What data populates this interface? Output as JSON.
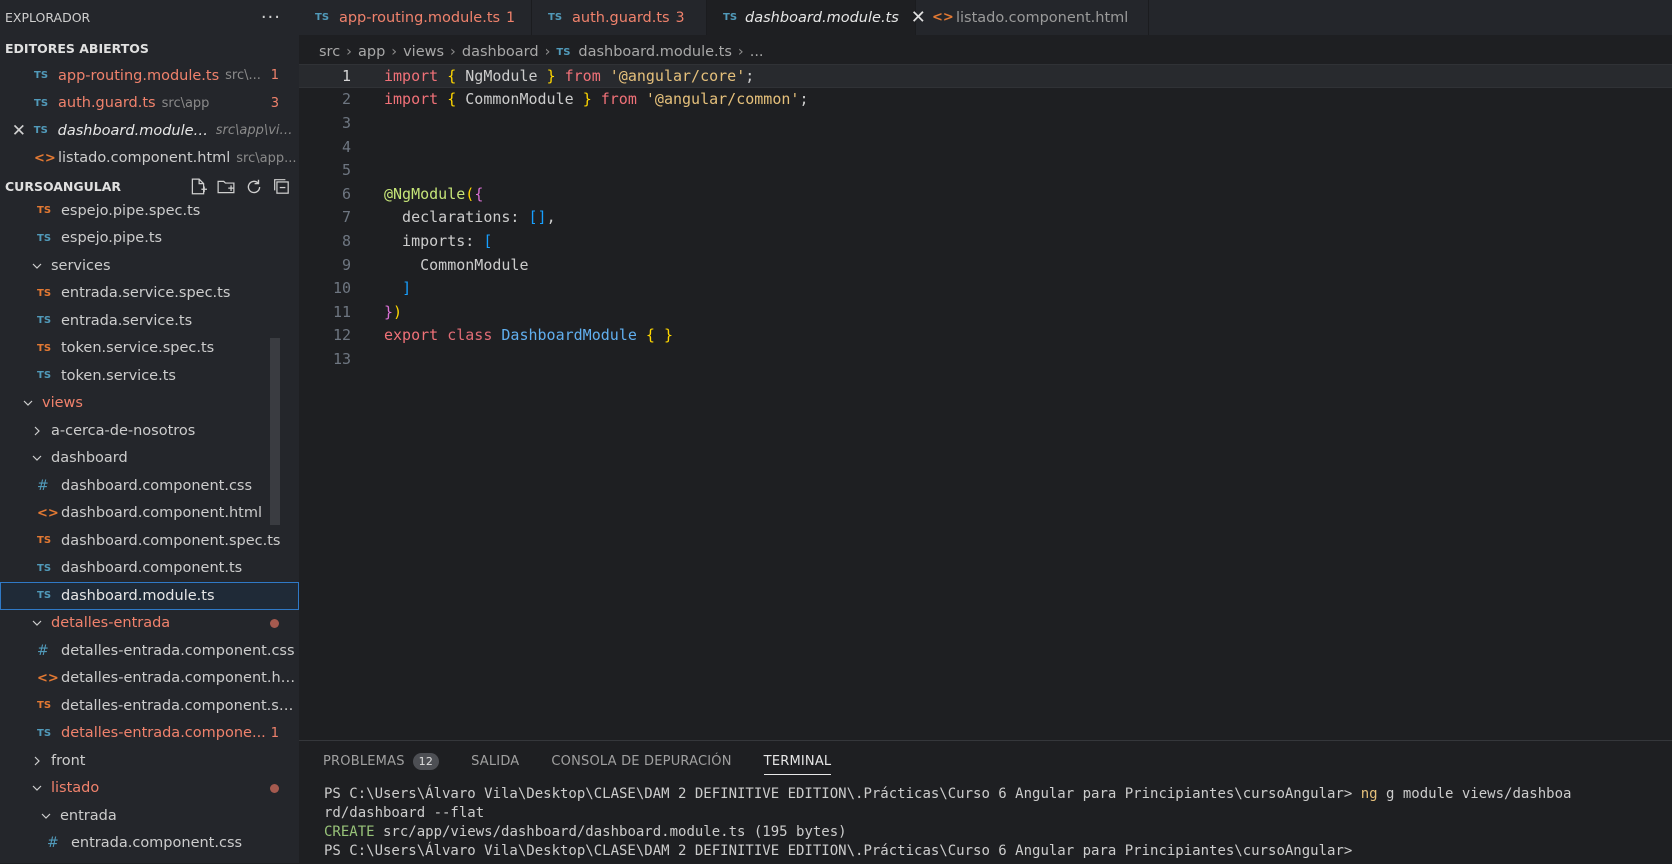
{
  "explorer": {
    "title": "EXPLORADOR",
    "more_label": "···",
    "open_editors_header": "EDITORES ABIERTOS",
    "open_editors": [
      {
        "name": "app-routing.module.ts",
        "path": "src\\...",
        "badge": "1"
      },
      {
        "name": "auth.guard.ts",
        "path": "src\\app",
        "badge": "3"
      },
      {
        "name": "dashboard.module.ts",
        "path": "src\\app\\vie..."
      },
      {
        "name": "listado.component.html",
        "path": "src\\app..."
      }
    ],
    "project_header": "CURSOANGULAR",
    "tree": [
      {
        "name": "espejo.pipe.spec.ts"
      },
      {
        "name": "espejo.pipe.ts"
      },
      {
        "name": "services"
      },
      {
        "name": "entrada.service.spec.ts"
      },
      {
        "name": "entrada.service.ts"
      },
      {
        "name": "token.service.spec.ts"
      },
      {
        "name": "token.service.ts"
      },
      {
        "name": "views"
      },
      {
        "name": "a-cerca-de-nosotros"
      },
      {
        "name": "dashboard"
      },
      {
        "name": "dashboard.component.css"
      },
      {
        "name": "dashboard.component.html"
      },
      {
        "name": "dashboard.component.spec.ts"
      },
      {
        "name": "dashboard.component.ts"
      },
      {
        "name": "dashboard.module.ts"
      },
      {
        "name": "detalles-entrada"
      },
      {
        "name": "detalles-entrada.component.css"
      },
      {
        "name": "detalles-entrada.component.ht..."
      },
      {
        "name": "detalles-entrada.component.sp..."
      },
      {
        "name": "detalles-entrada.compone...",
        "badge": "1"
      },
      {
        "name": "front"
      },
      {
        "name": "listado"
      },
      {
        "name": "entrada"
      },
      {
        "name": "entrada.component.css"
      }
    ]
  },
  "icons": {
    "ts": "TS",
    "html": "<>",
    "css": "#",
    "close": "✕"
  },
  "tabs": [
    {
      "label": "app-routing.module.ts",
      "count": "1"
    },
    {
      "label": "auth.guard.ts",
      "count": "3"
    },
    {
      "label": "dashboard.module.ts"
    },
    {
      "label": "listado.component.html"
    }
  ],
  "breadcrumb": [
    "src",
    "app",
    "views",
    "dashboard",
    "dashboard.module.ts",
    "..."
  ],
  "editor": {
    "line_numbers": [
      "1",
      "2",
      "3",
      "4",
      "5",
      "6",
      "7",
      "8",
      "9",
      "10",
      "11",
      "12",
      "13"
    ],
    "current_line": 1
  },
  "panel": {
    "tabs": [
      "PROBLEMAS",
      "SALIDA",
      "CONSOLA DE DEPURACIÓN",
      "TERMINAL"
    ],
    "problems_count": "12",
    "active_tab": "TERMINAL",
    "terminal": {
      "prompt1": "PS C:\\Users\\Álvaro Vila\\Desktop\\CLASE\\DAM 2 DEFINITIVE EDITION\\.Prácticas\\Curso 6 Angular para Principiantes\\cursoAngular> ",
      "cmd1": "ng",
      "args1": " g module views/dashboa",
      "line2": "rd/dashboard --flat",
      "create_word": "CREATE",
      "create_rest": " src/app/views/dashboard/dashboard.module.ts (195 bytes)",
      "line4": "PS C:\\Users\\Álvaro Vila\\Desktop\\CLASE\\DAM 2 DEFINITIVE EDITION\\.Prácticas\\Curso 6 Angular para Principiantes\\cursoAngular>"
    }
  }
}
